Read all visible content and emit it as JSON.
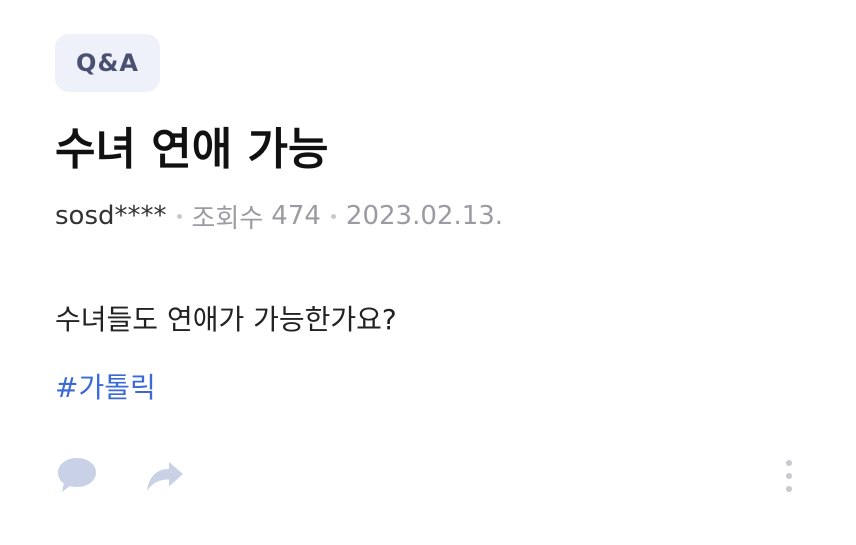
{
  "post": {
    "badge": "Q&A",
    "title": "수녀 연애 가능",
    "author": "sosd****",
    "views_label": "조회수",
    "views_count": "474",
    "date": "2023.02.13.",
    "body": "수녀들도 연애가 가능한가요?",
    "tag": "#가톨릭"
  },
  "actions": {
    "comment_icon": "comment-bubble-icon",
    "share_icon": "share-arrow-icon",
    "more_icon": "more-vertical-icon"
  },
  "colors": {
    "badge_bg": "#eef0fa",
    "badge_text": "#4a5170",
    "tag": "#3b69d6",
    "icon": "#c9d1e6",
    "muted_text": "#9a9ca3"
  }
}
